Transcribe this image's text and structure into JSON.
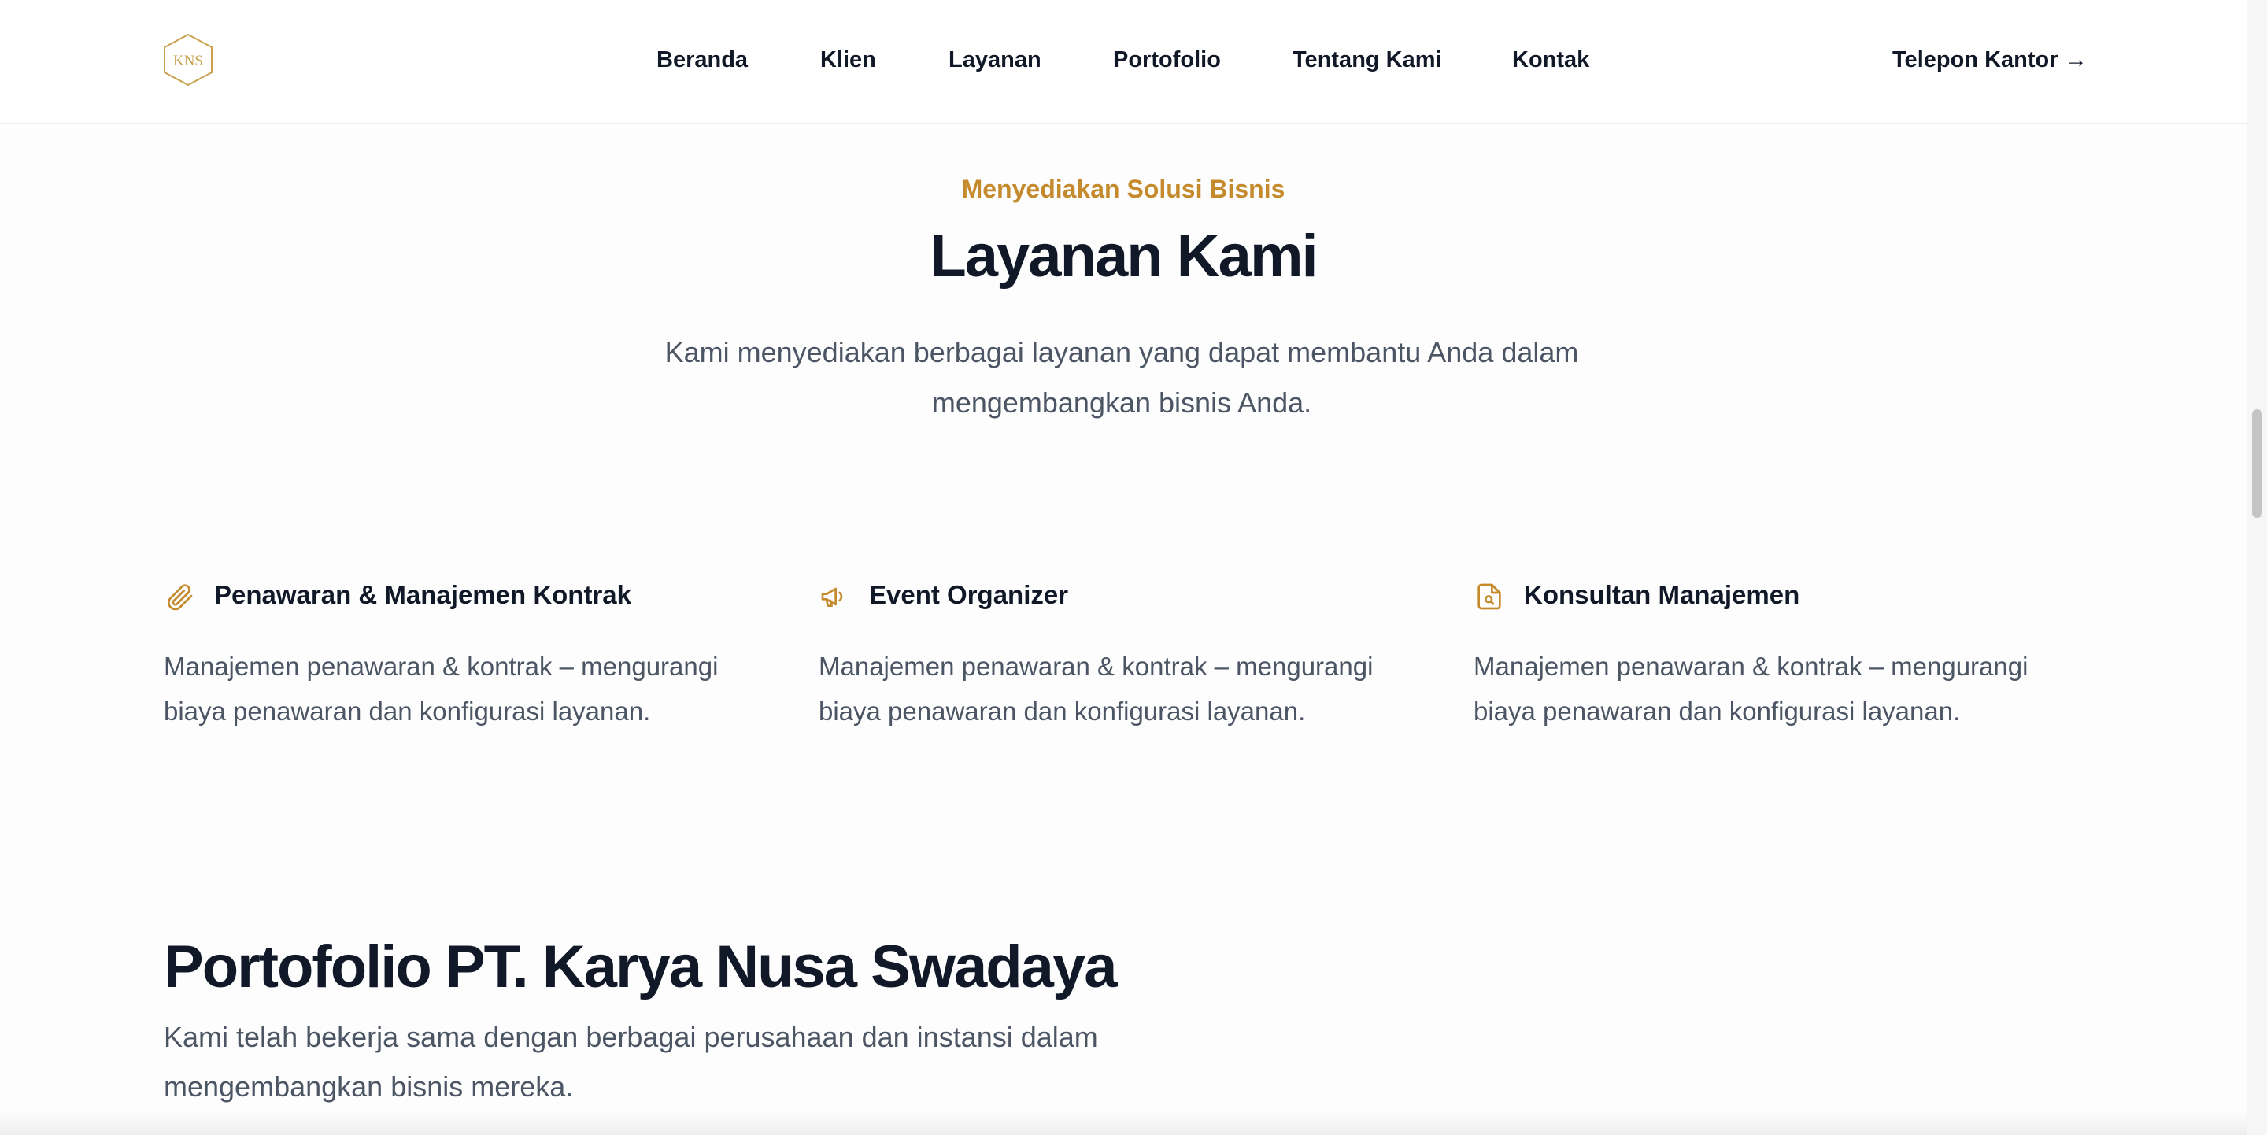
{
  "header": {
    "logo_text": "KNS",
    "nav": [
      "Beranda",
      "Klien",
      "Layanan",
      "Portofolio",
      "Tentang Kami",
      "Kontak"
    ],
    "cta_label": "Telepon Kantor →"
  },
  "services": {
    "eyebrow": "Menyediakan Solusi Bisnis",
    "title": "Layanan Kami",
    "description": "Kami menyediakan berbagai layanan yang dapat membantu Anda dalam mengembangkan bisnis Anda.",
    "cards": [
      {
        "icon": "paperclip-icon",
        "title": "Penawaran & Manajemen Kontrak",
        "description": "Manajemen penawaran & kontrak – mengurangi biaya penawaran dan konfigurasi layanan."
      },
      {
        "icon": "megaphone-icon",
        "title": "Event Organizer",
        "description": "Manajemen penawaran & kontrak – mengurangi biaya penawaran dan konfigurasi layanan."
      },
      {
        "icon": "document-search-icon",
        "title": "Konsultan Manajemen",
        "description": "Manajemen penawaran & kontrak – mengurangi biaya penawaran dan konfigurasi layanan."
      }
    ]
  },
  "portfolio": {
    "title": "Portofolio PT. Karya Nusa Swadaya",
    "description": "Kami telah bekerja sama dengan berbagai perusahaan dan instansi dalam mengembangkan bisnis mereka."
  },
  "colors": {
    "accent": "#c48a2c",
    "text": "#111827",
    "muted": "#4b5563"
  }
}
